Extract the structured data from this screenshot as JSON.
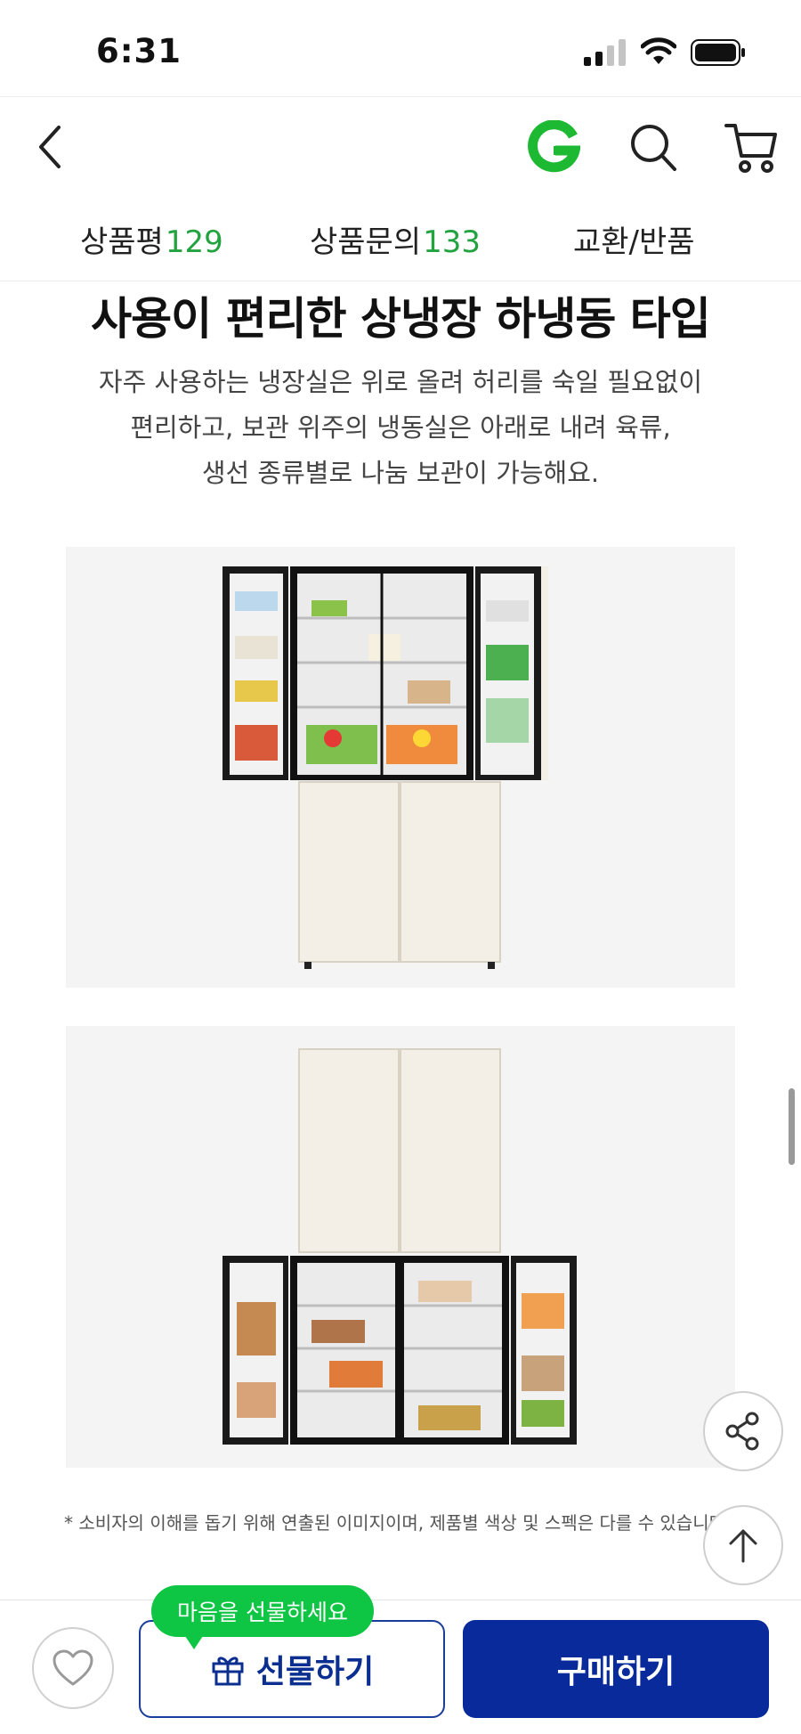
{
  "status_bar": {
    "time": "6:31"
  },
  "header": {
    "icons": [
      "back-icon",
      "g-logo-icon",
      "search-icon",
      "cart-icon"
    ]
  },
  "tabs": [
    {
      "label": "상품평",
      "count": "129"
    },
    {
      "label": "상품문의",
      "count": "133"
    },
    {
      "label": "교환/반품",
      "count": ""
    }
  ],
  "content": {
    "heading": "사용이 편리한 상냉장 하냉동 타입",
    "description_lines": [
      "자주 사용하는 냉장실은 위로 올려 허리를 숙일 필요없이",
      "편리하고, 보관 위주의 냉동실은 아래로 내려 육류,",
      "생선 종류별로 나눔 보관이 가능해요."
    ],
    "disclaimer": "* 소비자의 이해를 돕기 위해 연출된 이미지이며, 제품별 색상 및 스펙은 다를 수 있습니다."
  },
  "bottom_bar": {
    "tooltip": "마음을 선물하세요",
    "gift_label": "선물하기",
    "buy_label": "구매하기"
  },
  "colors": {
    "accent_green": "#22a340",
    "tooltip_green": "#0fc544",
    "brand_blue": "#082a9b",
    "panel_bg": "#f4f4f4",
    "fridge_cream": "#f3efe6"
  }
}
